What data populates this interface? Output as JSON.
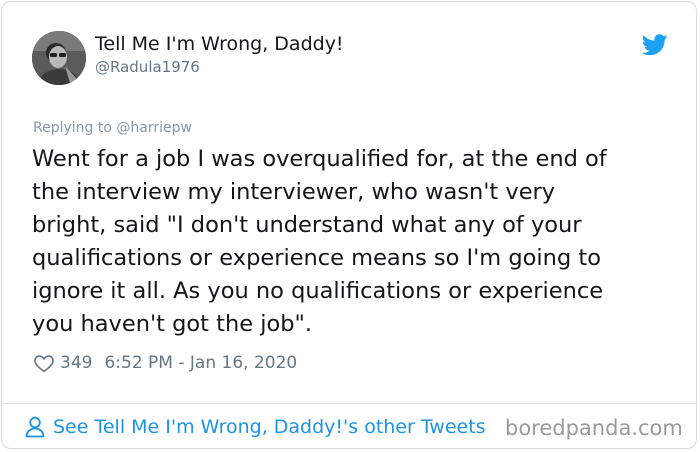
{
  "author": {
    "display_name": "Tell Me I'm Wrong, Daddy!",
    "handle": "@Radula1976",
    "avatar_icon": "user-avatar"
  },
  "reply": {
    "prefix": "Replying to ",
    "mention": "@harriepw"
  },
  "tweet": {
    "text": "Went for a job I was overqualified for, at the end of\nthe interview my interviewer, who wasn't very\nbright, said \"I don't understand what any of your\nqualifications or experience means so I'm going to\nignore it all. As you no qualifications or experience\nyou haven't got the job\"."
  },
  "meta": {
    "likes": "349",
    "timestamp": "6:52 PM - Jan 16, 2020",
    "like_icon": "heart-icon"
  },
  "footer": {
    "other_tweets_label": "See Tell Me I'm Wrong, Daddy!'s other Tweets",
    "person_icon": "person-icon"
  },
  "watermark": "boredpanda.com",
  "colors": {
    "text": "#14171a",
    "secondary": "#657786",
    "link": "#1b95e0",
    "twitter_blue": "#1da1f2",
    "border": "#d9d9d9"
  }
}
